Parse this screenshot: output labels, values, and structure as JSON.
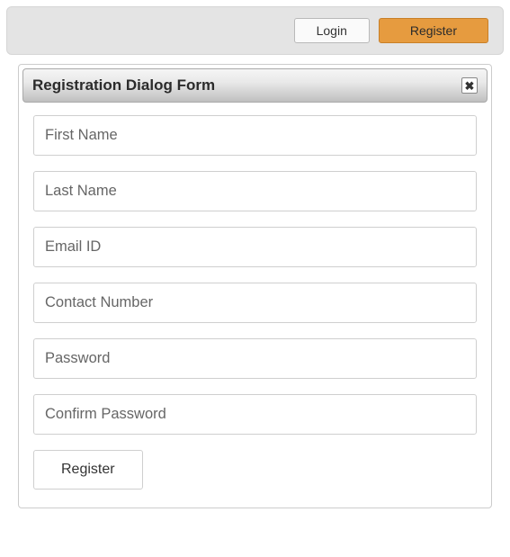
{
  "toolbar": {
    "login_label": "Login",
    "register_label": "Register"
  },
  "dialog": {
    "title": "Registration Dialog Form",
    "close_glyph": "✖",
    "fields": {
      "first_name": {
        "placeholder": "First Name",
        "value": ""
      },
      "last_name": {
        "placeholder": "Last Name",
        "value": ""
      },
      "email": {
        "placeholder": "Email ID",
        "value": ""
      },
      "contact": {
        "placeholder": "Contact Number",
        "value": ""
      },
      "password": {
        "placeholder": "Password",
        "value": ""
      },
      "confirm_password": {
        "placeholder": "Confirm Password",
        "value": ""
      }
    },
    "submit_label": "Register"
  }
}
